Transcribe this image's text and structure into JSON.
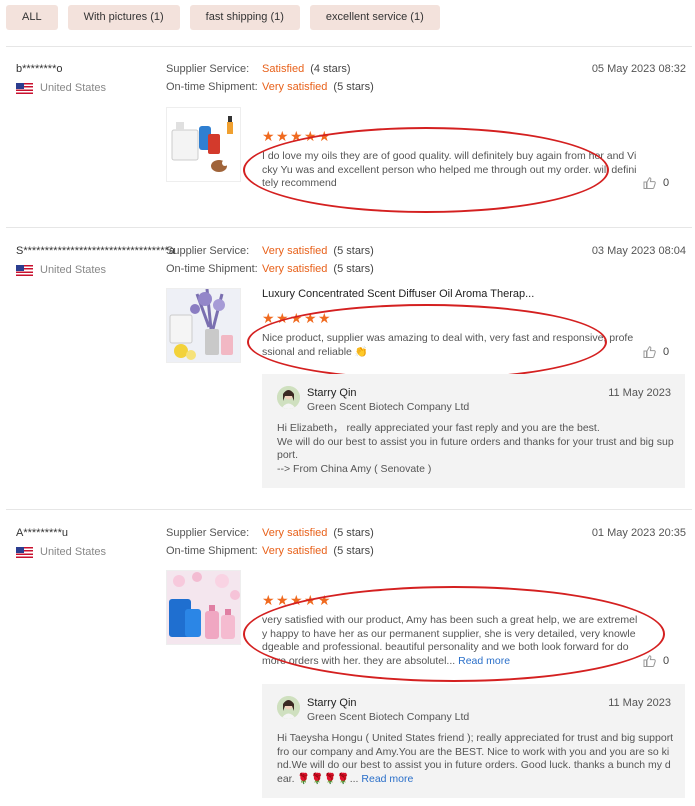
{
  "filters": [
    "ALL",
    "With pictures (1)",
    "fast shipping (1)",
    "excellent service (1)"
  ],
  "labels": {
    "supplier_service": "Supplier Service:",
    "ontime_shipment": "On-time Shipment:"
  },
  "reviews": [
    {
      "buyer": "b********o",
      "country": "United States",
      "date": "05 May 2023 08:32",
      "supplier_service": "Satisfied",
      "supplier_service_stars": "(4 stars)",
      "ontime": "Very satisfied",
      "ontime_stars": "(5 stars)",
      "product_title": "",
      "rating": 5,
      "content": "I do love my oils they are of good quality. will definitely buy again from her and Vicky Yu was and excellent person who helped me through out my order. will definitely recommend",
      "likes": "0"
    },
    {
      "buyer": "S**********************************a",
      "country": "United States",
      "date": "03 May 2023 08:04",
      "supplier_service": "Very satisfied",
      "supplier_service_stars": "(5 stars)",
      "ontime": "Very satisfied",
      "ontime_stars": "(5 stars)",
      "product_title": "Luxury Concentrated Scent Diffuser Oil Aroma Therap...",
      "rating": 5,
      "content": "Nice product,  supplier was amazing to deal with, very fast and responsive, professional and reliable 👏",
      "likes": "0",
      "reply": {
        "name": "Starry Qin",
        "company": "Green Scent Biotech Company Ltd",
        "date": "11 May 2023",
        "text": "Hi Elizabeth，  really appreciated your fast reply and you are the best.\nWe will do our best to assist you in future orders and thanks for your trust and big support.\n--> From China Amy ( Senovate )"
      }
    },
    {
      "buyer": "A*********u",
      "country": "United States",
      "date": "01 May 2023 20:35",
      "supplier_service": "Very satisfied",
      "supplier_service_stars": "(5 stars)",
      "ontime": "Very satisfied",
      "ontime_stars": "(5 stars)",
      "product_title": "",
      "rating": 5,
      "content": "very satisfied with our product, Amy has been such a great help, we are extremely happy to have her as our permanent supplier, she is very detailed, very knowledgeable and professional. beautiful personality and we both look forward for do more orders with her. they are absolutel...",
      "read_more": "Read more",
      "likes": "0",
      "reply": {
        "name": "Starry Qin",
        "company": "Green Scent Biotech Company Ltd",
        "date": "11 May 2023",
        "text": "Hi Taeysha Hongu ( United States friend ); really appreciated for trust and big support fro our company and Amy.You are the BEST. Nice to work with you and you are so kind.We will do our best to assist you in future orders. Good luck. thanks a bunch my dear. 🌹🌹🌹🌹...",
        "read_more": "Read more"
      }
    }
  ]
}
